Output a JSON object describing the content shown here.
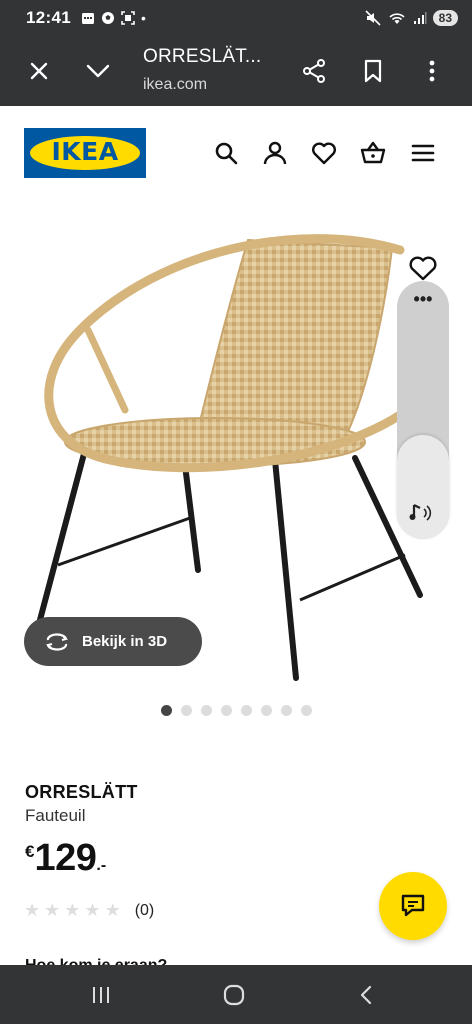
{
  "status_bar": {
    "time": "12:41",
    "battery": "83"
  },
  "browser": {
    "title": "ORRESLÄT...",
    "url": "ikea.com"
  },
  "header": {
    "logo_text": "IKEA"
  },
  "gallery": {
    "view_3d_label": "Bekijk in 3D",
    "dot_count": 8,
    "active_index": 0
  },
  "product": {
    "name": "ORRESLÄTT",
    "type": "Fauteuil",
    "price_currency": "€",
    "price_integer": "129",
    "price_decimal": ".-",
    "rating_count": "(0)",
    "stars": 5,
    "next_section_label": "Hoe kom je eraan?"
  },
  "colors": {
    "ikea_blue": "#0058a3",
    "ikea_yellow": "#ffdb00",
    "bar_dark": "#333436"
  }
}
